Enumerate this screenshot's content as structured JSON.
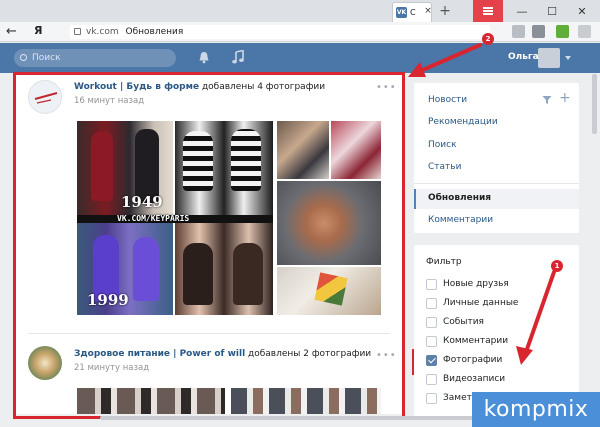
{
  "browser": {
    "tab_icon_text": "VK",
    "tab_title": "С",
    "tab_close": "×",
    "new_tab": "+",
    "yandex_logo": "Я",
    "url_domain": "vk.com",
    "url_page": "Обновления",
    "back": "←",
    "minimize": "—",
    "maximize": "☐",
    "close": "✕"
  },
  "vk_header": {
    "search_placeholder": "Поиск",
    "user_name": "Ольга"
  },
  "feed": {
    "posts": [
      {
        "source": "Workout | Будь в форме",
        "action": " добавлены 4 фотографии",
        "time": "16 минут назад",
        "menu": "•••"
      },
      {
        "source": "Здоровое питание | Power of will",
        "action": " добавлены 2 фотографии",
        "time": "21 минуту назад",
        "menu": "•••"
      }
    ],
    "watermarks": {
      "year_top": "1949",
      "vk_link": "VK.COM/KEYPARIS",
      "year_bottom": "1999"
    }
  },
  "right_nav": {
    "items": [
      "Новости",
      "Рекомендации",
      "Поиск",
      "Статьи"
    ],
    "active": "Обновления",
    "comments": "Комментарии"
  },
  "filter": {
    "heading": "Фильтр",
    "items": [
      {
        "label": "Новые друзья",
        "checked": false
      },
      {
        "label": "Личные данные",
        "checked": false
      },
      {
        "label": "События",
        "checked": false
      },
      {
        "label": "Комментарии",
        "checked": false
      },
      {
        "label": "Фотографии",
        "checked": true
      },
      {
        "label": "Видеозаписи",
        "checked": false
      },
      {
        "label": "Заметки",
        "checked": false
      }
    ]
  },
  "annotations": {
    "badge_1": "1",
    "badge_2": "2",
    "accent": "#d9252f"
  },
  "brand": {
    "watermark": "kompmix"
  }
}
